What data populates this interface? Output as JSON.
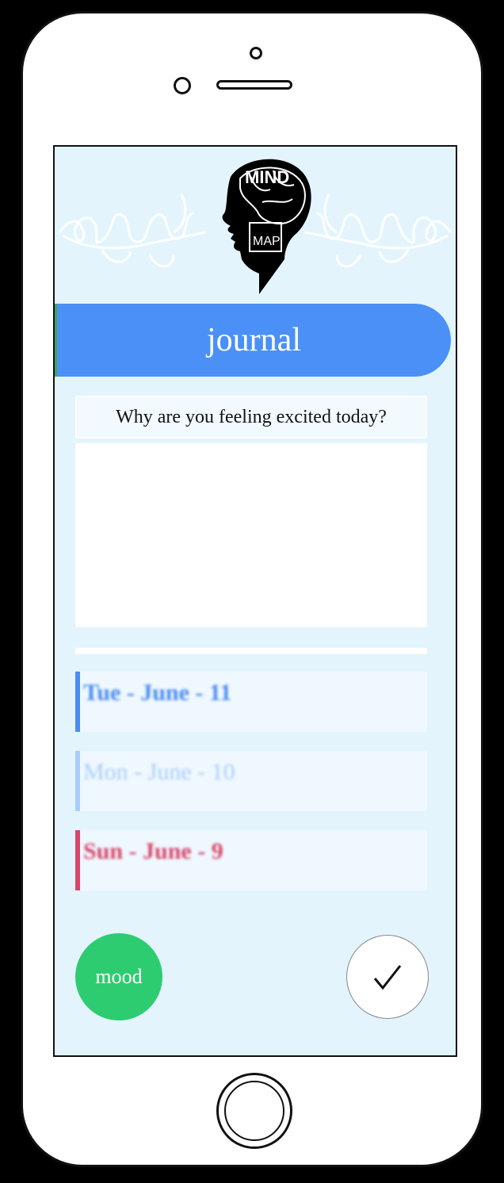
{
  "app": {
    "logo_text": "MIND MAP",
    "title": "journal"
  },
  "journal": {
    "prompt": "Why are you feeling excited today?",
    "entry_value": "",
    "entry_placeholder": ""
  },
  "entries": [
    {
      "label": "Tue - June - 11",
      "color": "#4a8cf2"
    },
    {
      "label": "Mon - June - 10",
      "color": "#a9cdfb"
    },
    {
      "label": "Sun - June - 9",
      "color": "#d8466b"
    }
  ],
  "actions": {
    "mood_label": "mood",
    "check_icon": "check-icon"
  },
  "colors": {
    "screen_bg": "#e3f4fd",
    "banner": "#4a90f7",
    "mood": "#2ecc71"
  }
}
